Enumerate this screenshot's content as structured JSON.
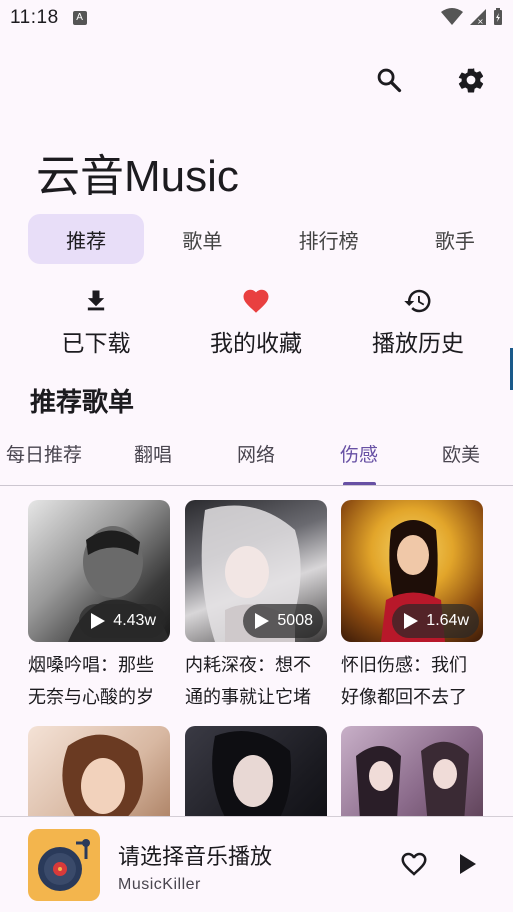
{
  "status_bar": {
    "time": "11:18",
    "a_badge": "A"
  },
  "header": {
    "app_title": "云音Music"
  },
  "tabs": [
    {
      "label": "推荐",
      "active": true
    },
    {
      "label": "歌单",
      "active": false
    },
    {
      "label": "排行榜",
      "active": false
    },
    {
      "label": "歌手",
      "active": false
    }
  ],
  "quick_actions": [
    {
      "label": "已下载",
      "icon": "download-icon"
    },
    {
      "label": "我的收藏",
      "icon": "heart-icon"
    },
    {
      "label": "播放历史",
      "icon": "history-icon"
    }
  ],
  "section": {
    "title": "推荐歌单"
  },
  "subtabs": [
    {
      "label": "每日推荐",
      "active": false
    },
    {
      "label": "翻唱",
      "active": false
    },
    {
      "label": "网络",
      "active": false
    },
    {
      "label": "伤感",
      "active": true
    },
    {
      "label": "欧美",
      "active": false
    }
  ],
  "playlists": [
    {
      "title": "烟嗓吟唱：那些无奈与心酸的岁",
      "play_count": "4.43w"
    },
    {
      "title": "内耗深夜：想不通的事就让它堵",
      "play_count": "5008"
    },
    {
      "title": "怀旧伤感：我们好像都回不去了",
      "play_count": "1.64w"
    },
    {
      "title": "",
      "play_count": ""
    },
    {
      "title": "",
      "play_count": ""
    },
    {
      "title": "",
      "play_count": ""
    }
  ],
  "player": {
    "song": "请选择音乐播放",
    "artist": "MusicKiller"
  },
  "colors": {
    "accent": "#6750a4",
    "active_tab_bg": "#e8def8",
    "heart": "#e94040",
    "background": "#fdf7fd"
  }
}
